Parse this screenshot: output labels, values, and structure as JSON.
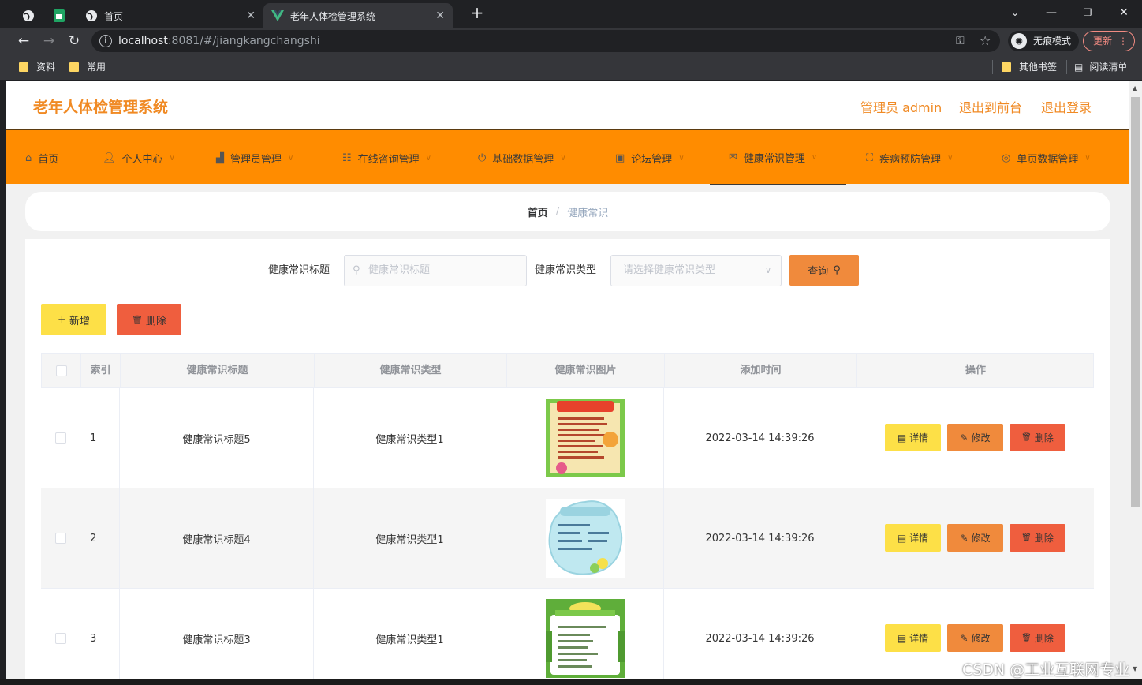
{
  "browser": {
    "tabs": [
      {
        "title": "",
        "icon": "globe-icon"
      },
      {
        "title": "",
        "icon": "sheets-icon"
      },
      {
        "title": "首页",
        "icon": "globe-icon"
      },
      {
        "title": "老年人体检管理系统",
        "icon": "vue-icon"
      }
    ],
    "url_host": "localhost",
    "url_path": ":8081/#/jiangkangchangshi",
    "incognito_label": "无痕模式",
    "update_label": "更新",
    "bookmarks": [
      "资料",
      "常用"
    ],
    "other_bookmarks": "其他书签",
    "reading_list": "阅读清单"
  },
  "header": {
    "brand": "老年人体检管理系统",
    "admin": "管理员 admin",
    "to_front": "退出到前台",
    "logout": "退出登录"
  },
  "menu": [
    {
      "label": "首页",
      "icon": "home-icon"
    },
    {
      "label": "个人中心",
      "icon": "user-icon"
    },
    {
      "label": "管理员管理",
      "icon": "admin-icon"
    },
    {
      "label": "在线咨询管理",
      "icon": "grid-icon"
    },
    {
      "label": "基础数据管理",
      "icon": "power-icon"
    },
    {
      "label": "论坛管理",
      "icon": "clipboard-icon"
    },
    {
      "label": "健康常识管理",
      "icon": "mail-icon"
    },
    {
      "label": "疾病预防管理",
      "icon": "frame-icon"
    },
    {
      "label": "单页数据管理",
      "icon": "target-icon"
    }
  ],
  "breadcrumb": {
    "home": "首页",
    "current": "健康常识"
  },
  "search": {
    "title_label": "健康常识标题",
    "title_placeholder": "健康常识标题",
    "type_label": "健康常识类型",
    "type_placeholder": "请选择健康常识类型",
    "query_label": "查询"
  },
  "actions": {
    "add_label": "新增",
    "delete_label": "删除"
  },
  "table": {
    "headers": [
      "",
      "索引",
      "健康常识标题",
      "健康常识类型",
      "健康常识图片",
      "添加时间",
      "操作"
    ],
    "rows": [
      {
        "index": "1",
        "title": "健康常识标题5",
        "type": "健康常识类型1",
        "time": "2022-03-14 14:39:26"
      },
      {
        "index": "2",
        "title": "健康常识标题4",
        "type": "健康常识类型1",
        "time": "2022-03-14 14:39:26"
      },
      {
        "index": "3",
        "title": "健康常识标题3",
        "type": "健康常识类型1",
        "time": "2022-03-14 14:39:26"
      }
    ],
    "row_buttons": {
      "detail": "详情",
      "edit": "修改",
      "delete": "删除"
    }
  },
  "watermark": "CSDN @工业互联网专业"
}
